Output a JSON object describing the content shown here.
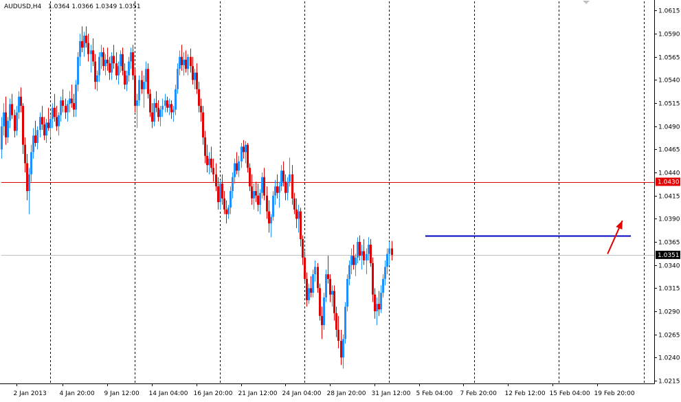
{
  "header": {
    "symbol": "AUDUSD,H4",
    "ohlc": "1.0364 1.0366 1.0349 1.0351",
    "dropdown_icon": "triangle-down-icon"
  },
  "colors": {
    "background": "#ffffff",
    "axis": "#000000",
    "grid": "#000000",
    "bull": "#1e90ff",
    "bear": "#e00000",
    "resistance_line": "#0000c0",
    "level_line": "#e00000",
    "current_line": "#c0c0c0",
    "arrow": "#e00000",
    "level_tag_bg": "#e00000",
    "current_tag_bg": "#000000",
    "tag_text": "#ffffff"
  },
  "chart_data": {
    "type": "candlestick",
    "symbol": "AUDUSD",
    "timeframe": "H4",
    "ylim": [
      1.0212,
      1.0625
    ],
    "xlim": [
      0,
      308
    ],
    "y_ticks": [
      "1.0615",
      "1.0590",
      "1.0565",
      "1.0540",
      "1.0515",
      "1.0490",
      "1.0465",
      "1.0440",
      "1.0415",
      "1.0390",
      "1.0365",
      "1.0340",
      "1.0315",
      "1.0290",
      "1.0265",
      "1.0240",
      "1.0215"
    ],
    "x_labels": [
      {
        "label": "2 Jan 2013",
        "x": 7
      },
      {
        "label": "4 Jan 20:00",
        "x": 29
      },
      {
        "label": "9 Jan 12:00",
        "x": 50
      },
      {
        "label": "14 Jan 04:00",
        "x": 71
      },
      {
        "label": "16 Jan 20:00",
        "x": 92
      },
      {
        "label": "21 Jan 12:00",
        "x": 113
      },
      {
        "label": "24 Jan 04:00",
        "x": 134
      },
      {
        "label": "28 Jan 20:00",
        "x": 155
      },
      {
        "label": "31 Jan 12:00",
        "x": 176
      },
      {
        "label": "5 Feb 04:00",
        "x": 197
      },
      {
        "label": "7 Feb 20:00",
        "x": 218
      },
      {
        "label": "12 Feb 12:00",
        "x": 239
      },
      {
        "label": "15 Feb 04:00",
        "x": 260
      },
      {
        "label": "19 Feb 20:00",
        "x": 281
      }
    ],
    "vgrid_x": [
      23,
      63,
      103,
      143,
      183,
      223,
      263,
      303
    ],
    "candles": [
      [
        1.0465,
        1.05,
        1.0455,
        1.049
      ],
      [
        1.049,
        1.0515,
        1.048,
        1.0505
      ],
      [
        1.0505,
        1.0522,
        1.047,
        1.0478
      ],
      [
        1.0478,
        1.05,
        1.0472,
        1.0496
      ],
      [
        1.0496,
        1.052,
        1.0488,
        1.0514
      ],
      [
        1.0514,
        1.0525,
        1.0498,
        1.0502
      ],
      [
        1.0502,
        1.0508,
        1.0478,
        1.0485
      ],
      [
        1.0485,
        1.0512,
        1.048,
        1.0505
      ],
      [
        1.0505,
        1.0528,
        1.0498,
        1.0522
      ],
      [
        1.0522,
        1.0532,
        1.0505,
        1.0512
      ],
      [
        1.0512,
        1.0515,
        1.046,
        1.047
      ],
      [
        1.047,
        1.0478,
        1.044,
        1.045
      ],
      [
        1.045,
        1.046,
        1.041,
        1.042
      ],
      [
        1.042,
        1.0445,
        1.0395,
        1.0438
      ],
      [
        1.0438,
        1.047,
        1.043,
        1.0462
      ],
      [
        1.0462,
        1.0488,
        1.0455,
        1.048
      ],
      [
        1.048,
        1.0496,
        1.0468,
        1.0472
      ],
      [
        1.0472,
        1.049,
        1.0465,
        1.0486
      ],
      [
        1.0486,
        1.0505,
        1.0478,
        1.05
      ],
      [
        1.05,
        1.0512,
        1.0486,
        1.0492
      ],
      [
        1.0492,
        1.05,
        1.0475,
        1.048
      ],
      [
        1.048,
        1.0498,
        1.0472,
        1.0494
      ],
      [
        1.0494,
        1.051,
        1.0485,
        1.0488
      ],
      [
        1.0488,
        1.0502,
        1.0478,
        1.0498
      ],
      [
        1.0498,
        1.0515,
        1.0488,
        1.051
      ],
      [
        1.051,
        1.0525,
        1.0495,
        1.05
      ],
      [
        1.05,
        1.0512,
        1.0485,
        1.049
      ],
      [
        1.049,
        1.0505,
        1.048,
        1.0502
      ],
      [
        1.0502,
        1.0522,
        1.0495,
        1.0518
      ],
      [
        1.0518,
        1.053,
        1.0505,
        1.0512
      ],
      [
        1.0512,
        1.052,
        1.0498,
        1.0505
      ],
      [
        1.0505,
        1.0518,
        1.0495,
        1.0514
      ],
      [
        1.0514,
        1.0528,
        1.0505,
        1.052
      ],
      [
        1.052,
        1.0535,
        1.051,
        1.0515
      ],
      [
        1.0515,
        1.0525,
        1.05,
        1.0508
      ],
      [
        1.0508,
        1.054,
        1.05,
        1.0535
      ],
      [
        1.0535,
        1.057,
        1.0528,
        1.0565
      ],
      [
        1.0565,
        1.059,
        1.0555,
        1.0582
      ],
      [
        1.0582,
        1.0598,
        1.057,
        1.0575
      ],
      [
        1.0575,
        1.0592,
        1.0565,
        1.0588
      ],
      [
        1.0588,
        1.0598,
        1.0575,
        1.058
      ],
      [
        1.058,
        1.059,
        1.056,
        1.0568
      ],
      [
        1.0568,
        1.0578,
        1.0548,
        1.0572
      ],
      [
        1.0572,
        1.0585,
        1.0555,
        1.056
      ],
      [
        1.056,
        1.0568,
        1.053,
        1.0538
      ],
      [
        1.0538,
        1.055,
        1.0528,
        1.0545
      ],
      [
        1.0545,
        1.057,
        1.0538,
        1.0565
      ],
      [
        1.0565,
        1.0578,
        1.0552,
        1.057
      ],
      [
        1.057,
        1.0575,
        1.055,
        1.0555
      ],
      [
        1.0555,
        1.0568,
        1.0545,
        1.0562
      ],
      [
        1.0562,
        1.0575,
        1.055,
        1.0558
      ],
      [
        1.0558,
        1.0565,
        1.054,
        1.0548
      ],
      [
        1.0548,
        1.057,
        1.054,
        1.0566
      ],
      [
        1.0566,
        1.0578,
        1.0552,
        1.0558
      ],
      [
        1.0558,
        1.057,
        1.054,
        1.0545
      ],
      [
        1.0545,
        1.056,
        1.0535,
        1.0555
      ],
      [
        1.0555,
        1.0572,
        1.0548,
        1.0568
      ],
      [
        1.0568,
        1.0575,
        1.0545,
        1.055
      ],
      [
        1.055,
        1.0558,
        1.053,
        1.0535
      ],
      [
        1.0535,
        1.055,
        1.0528,
        1.0545
      ],
      [
        1.0545,
        1.0565,
        1.0538,
        1.056
      ],
      [
        1.056,
        1.0575,
        1.0552,
        1.057
      ],
      [
        1.057,
        1.0578,
        1.054,
        1.0545
      ],
      [
        1.0545,
        1.0552,
        1.0505,
        1.0512
      ],
      [
        1.0512,
        1.0525,
        1.0488,
        1.0518
      ],
      [
        1.0518,
        1.0545,
        1.0512,
        1.054
      ],
      [
        1.054,
        1.055,
        1.0525,
        1.053
      ],
      [
        1.053,
        1.0545,
        1.051,
        1.0538
      ],
      [
        1.0538,
        1.056,
        1.053,
        1.0552
      ],
      [
        1.0552,
        1.0558,
        1.052,
        1.0525
      ],
      [
        1.0525,
        1.053,
        1.05,
        1.0505
      ],
      [
        1.0505,
        1.0515,
        1.0488,
        1.0495
      ],
      [
        1.0495,
        1.052,
        1.049,
        1.0515
      ],
      [
        1.0515,
        1.0528,
        1.0505,
        1.051
      ],
      [
        1.051,
        1.0518,
        1.0495,
        1.05
      ],
      [
        1.05,
        1.0512,
        1.049,
        1.0508
      ],
      [
        1.0508,
        1.052,
        1.05,
        1.0512
      ],
      [
        1.0512,
        1.0525,
        1.0505,
        1.0518
      ],
      [
        1.0518,
        1.0522,
        1.0505,
        1.051
      ],
      [
        1.051,
        1.052,
        1.0502,
        1.0514
      ],
      [
        1.0514,
        1.0518,
        1.0498,
        1.0505
      ],
      [
        1.0505,
        1.0512,
        1.0495,
        1.0508
      ],
      [
        1.0508,
        1.0535,
        1.0502,
        1.053
      ],
      [
        1.053,
        1.0558,
        1.0525,
        1.0552
      ],
      [
        1.0552,
        1.0572,
        1.0545,
        1.0565
      ],
      [
        1.0565,
        1.0578,
        1.055,
        1.0556
      ],
      [
        1.0556,
        1.057,
        1.0545,
        1.0562
      ],
      [
        1.0562,
        1.0572,
        1.0548,
        1.0552
      ],
      [
        1.0552,
        1.0568,
        1.0545,
        1.0565
      ],
      [
        1.0565,
        1.0574,
        1.0548,
        1.0555
      ],
      [
        1.0555,
        1.0565,
        1.0535,
        1.054
      ],
      [
        1.054,
        1.0552,
        1.053,
        1.0548
      ],
      [
        1.0548,
        1.0558,
        1.0525,
        1.053
      ],
      [
        1.053,
        1.0538,
        1.0505,
        1.0512
      ],
      [
        1.0512,
        1.052,
        1.0495,
        1.0505
      ],
      [
        1.0505,
        1.0512,
        1.047,
        1.0478
      ],
      [
        1.0478,
        1.0485,
        1.045,
        1.0458
      ],
      [
        1.0458,
        1.047,
        1.044,
        1.0448
      ],
      [
        1.0448,
        1.0462,
        1.0438,
        1.0455
      ],
      [
        1.0455,
        1.0468,
        1.044,
        1.0445
      ],
      [
        1.0445,
        1.0455,
        1.043,
        1.0438
      ],
      [
        1.0438,
        1.045,
        1.042,
        1.0425
      ],
      [
        1.0425,
        1.0435,
        1.04,
        1.0408
      ],
      [
        1.0408,
        1.0432,
        1.04,
        1.0428
      ],
      [
        1.0428,
        1.0438,
        1.0405,
        1.0412
      ],
      [
        1.0412,
        1.042,
        1.0395,
        1.04
      ],
      [
        1.04,
        1.041,
        1.0385,
        1.0395
      ],
      [
        1.0395,
        1.0405,
        1.039,
        1.0402
      ],
      [
        1.0402,
        1.0425,
        1.0395,
        1.042
      ],
      [
        1.042,
        1.044,
        1.0412,
        1.0435
      ],
      [
        1.0435,
        1.0455,
        1.0428,
        1.045
      ],
      [
        1.045,
        1.0462,
        1.0438,
        1.0442
      ],
      [
        1.0442,
        1.0458,
        1.0435,
        1.0452
      ],
      [
        1.0452,
        1.0472,
        1.0445,
        1.0468
      ],
      [
        1.0468,
        1.0475,
        1.0455,
        1.0462
      ],
      [
        1.0462,
        1.0474,
        1.045,
        1.047
      ],
      [
        1.047,
        1.0472,
        1.044,
        1.0445
      ],
      [
        1.0445,
        1.045,
        1.042,
        1.0425
      ],
      [
        1.0425,
        1.0438,
        1.0405,
        1.0412
      ],
      [
        1.0412,
        1.0428,
        1.04,
        1.042
      ],
      [
        1.042,
        1.043,
        1.0408,
        1.0415
      ],
      [
        1.0415,
        1.0428,
        1.0398,
        1.0405
      ],
      [
        1.0405,
        1.0422,
        1.0395,
        1.0418
      ],
      [
        1.0418,
        1.044,
        1.0412,
        1.0435
      ],
      [
        1.0435,
        1.0445,
        1.041,
        1.0415
      ],
      [
        1.0415,
        1.0425,
        1.039,
        1.0398
      ],
      [
        1.0398,
        1.041,
        1.0375,
        1.0385
      ],
      [
        1.0385,
        1.0395,
        1.037,
        1.0392
      ],
      [
        1.0392,
        1.042,
        1.0388,
        1.0415
      ],
      [
        1.0415,
        1.0432,
        1.0405,
        1.0425
      ],
      [
        1.0425,
        1.0438,
        1.0412,
        1.0418
      ],
      [
        1.0418,
        1.043,
        1.0402,
        1.0425
      ],
      [
        1.0425,
        1.0448,
        1.042,
        1.0442
      ],
      [
        1.0442,
        1.0452,
        1.0425,
        1.043
      ],
      [
        1.043,
        1.0438,
        1.041,
        1.0418
      ],
      [
        1.0418,
        1.0435,
        1.041,
        1.043
      ],
      [
        1.043,
        1.0456,
        1.0425,
        1.0438
      ],
      [
        1.0438,
        1.0448,
        1.0405,
        1.0412
      ],
      [
        1.0412,
        1.0418,
        1.0395,
        1.04
      ],
      [
        1.04,
        1.0412,
        1.038,
        1.039
      ],
      [
        1.039,
        1.0405,
        1.0375,
        1.0398
      ],
      [
        1.0398,
        1.0402,
        1.036,
        1.0368
      ],
      [
        1.0368,
        1.0372,
        1.034,
        1.0348
      ],
      [
        1.0348,
        1.0355,
        1.032,
        1.0325
      ],
      [
        1.0325,
        1.0332,
        1.0295,
        1.0302
      ],
      [
        1.0302,
        1.032,
        1.0298,
        1.0315
      ],
      [
        1.0315,
        1.0328,
        1.0305,
        1.031
      ],
      [
        1.031,
        1.0335,
        1.0305,
        1.033
      ],
      [
        1.033,
        1.0345,
        1.0322,
        1.0338
      ],
      [
        1.0338,
        1.0342,
        1.031,
        1.0315
      ],
      [
        1.0315,
        1.032,
        1.028,
        1.0285
      ],
      [
        1.0285,
        1.0295,
        1.026,
        1.0275
      ],
      [
        1.0275,
        1.031,
        1.027,
        1.0305
      ],
      [
        1.0305,
        1.0335,
        1.03,
        1.033
      ],
      [
        1.033,
        1.035,
        1.032,
        1.0325
      ],
      [
        1.0325,
        1.033,
        1.03,
        1.0308
      ],
      [
        1.0308,
        1.0318,
        1.0295,
        1.0312
      ],
      [
        1.0312,
        1.0318,
        1.028,
        1.0288
      ],
      [
        1.0288,
        1.0295,
        1.0262,
        1.027
      ],
      [
        1.027,
        1.0285,
        1.025,
        1.0258
      ],
      [
        1.0258,
        1.027,
        1.0232,
        1.024
      ],
      [
        1.024,
        1.0265,
        1.0228,
        1.026
      ],
      [
        1.026,
        1.03,
        1.0255,
        1.0295
      ],
      [
        1.0295,
        1.033,
        1.029,
        1.0325
      ],
      [
        1.0325,
        1.0345,
        1.0318,
        1.034
      ],
      [
        1.034,
        1.0358,
        1.033,
        1.035
      ],
      [
        1.035,
        1.0362,
        1.0335,
        1.034
      ],
      [
        1.034,
        1.0352,
        1.0328,
        1.0348
      ],
      [
        1.0348,
        1.037,
        1.0342,
        1.0365
      ],
      [
        1.0365,
        1.0372,
        1.0345,
        1.035
      ],
      [
        1.035,
        1.0362,
        1.0335,
        1.0355
      ],
      [
        1.0355,
        1.0368,
        1.034,
        1.0345
      ],
      [
        1.0345,
        1.0358,
        1.033,
        1.0352
      ],
      [
        1.0352,
        1.037,
        1.0345,
        1.0362
      ],
      [
        1.0362,
        1.0368,
        1.0338,
        1.0342
      ],
      [
        1.0342,
        1.0348,
        1.03,
        1.0308
      ],
      [
        1.0308,
        1.0315,
        1.0282,
        1.029
      ],
      [
        1.029,
        1.0305,
        1.0275,
        1.0298
      ],
      [
        1.0298,
        1.0312,
        1.0285,
        1.0292
      ],
      [
        1.0292,
        1.0318,
        1.0288,
        1.031
      ],
      [
        1.031,
        1.033,
        1.0305,
        1.0325
      ],
      [
        1.0325,
        1.0345,
        1.0318,
        1.0338
      ],
      [
        1.0338,
        1.0358,
        1.033,
        1.0352
      ],
      [
        1.0352,
        1.0365,
        1.034,
        1.0358
      ],
      [
        1.0358,
        1.0366,
        1.0345,
        1.0351
      ]
    ],
    "horizontal_lines": [
      {
        "name": "level",
        "price": 1.043,
        "label": "1.0430"
      },
      {
        "name": "current",
        "price": 1.0351,
        "label": "1.0351"
      }
    ],
    "resistance": {
      "price": 1.0372,
      "x_start": 200,
      "x_end": 297
    },
    "arrow": {
      "from": [
        286,
        1.0352
      ],
      "to": [
        293,
        1.0388
      ]
    }
  }
}
